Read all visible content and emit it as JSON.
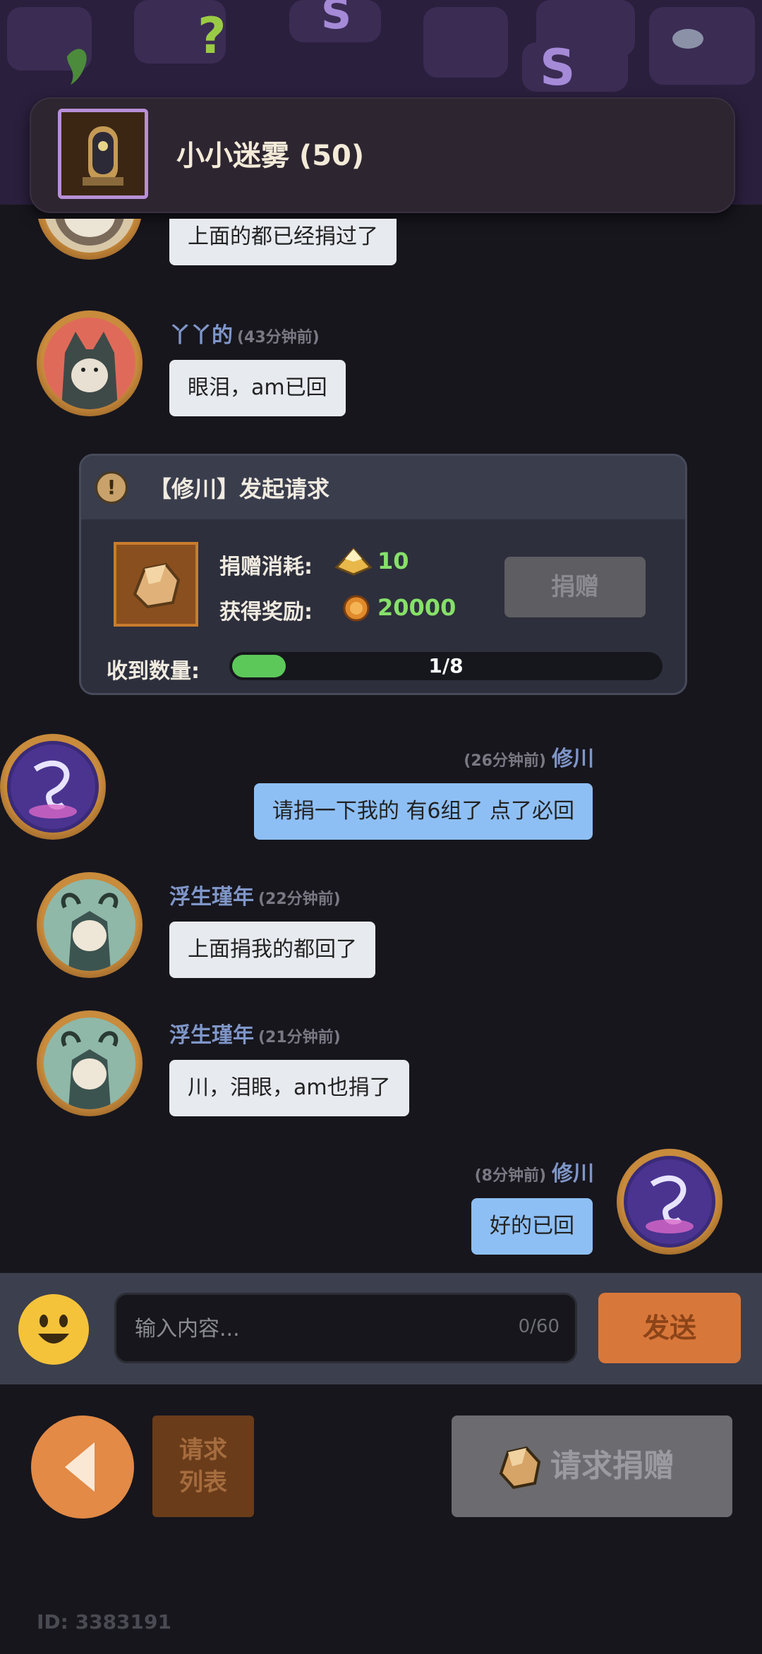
{
  "guild": {
    "name": "小小迷雾 (50)"
  },
  "messages": [
    {
      "side": "left",
      "name": "",
      "time": "",
      "text": "上面的都已经捐过了"
    },
    {
      "side": "left",
      "name": "丫丫的",
      "time": "(43分钟前)",
      "text": "眼泪，am已回"
    },
    {
      "side": "right",
      "name": "修川",
      "time": "(26分钟前)",
      "text": "请捐一下我的 有6组了 点了必回"
    },
    {
      "side": "left",
      "name": "浮生瑾年",
      "time": "(22分钟前)",
      "text": "上面捐我的都回了"
    },
    {
      "side": "left",
      "name": "浮生瑾年",
      "time": "(21分钟前)",
      "text": "川，泪眼，am也捐了"
    },
    {
      "side": "right",
      "name": "修川",
      "time": "(8分钟前)",
      "text": "好的已回"
    }
  ],
  "request_card": {
    "icon": "!",
    "title": "【修川】发起请求",
    "cost_label": "捐赠消耗:",
    "cost_value": "10",
    "reward_label": "获得奖励:",
    "reward_value": "20000",
    "donate_label": "捐赠",
    "received_label": "收到数量:",
    "received_text": "1/8",
    "received_fraction": 0.125
  },
  "input": {
    "placeholder": "输入内容...",
    "char_count": "0/60",
    "send_label": "发送"
  },
  "bottom": {
    "request_list_label": "请求列表",
    "request_donate_label": "请求捐赠",
    "user_id": "ID: 3383191"
  },
  "colors": {
    "accent_orange": "#d8773a",
    "name_blue": "#7f96c8",
    "progress_green": "#5cc85a"
  }
}
